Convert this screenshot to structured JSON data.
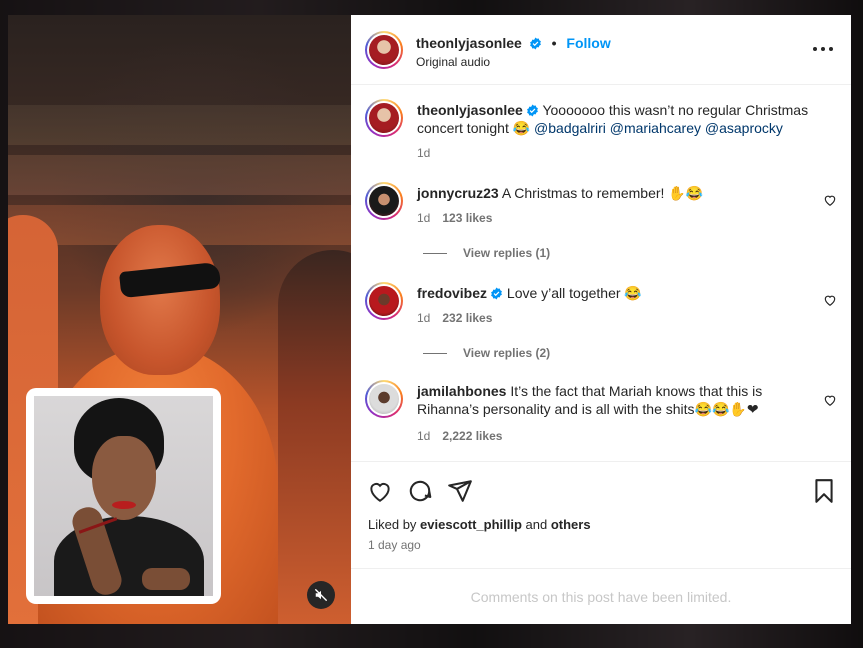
{
  "post": {
    "author": "theonlyjasonlee",
    "follow_label": "Follow",
    "separator": "•",
    "audio": "Original audio",
    "caption": {
      "username": "theonlyjasonlee",
      "text": "Yooooooo this wasn’t no regular Christmas concert tonight 😂 ",
      "mentions": [
        "@badgalriri",
        "@mariahcarey",
        "@asaprocky"
      ],
      "time": "1d"
    }
  },
  "comments": [
    {
      "username": "jonnycruz23",
      "verified": false,
      "text": "A Christmas to remember! ✋😂",
      "time": "1d",
      "likes": "123 likes",
      "replies": "View replies (1)"
    },
    {
      "username": "fredovibez",
      "verified": true,
      "text": "Love y’all together 😂",
      "time": "1d",
      "likes": "232 likes",
      "replies": "View replies (2)"
    },
    {
      "username": "jamilahbones",
      "verified": false,
      "text": "It’s the fact that Mariah knows that this is Rihanna’s personality and is all with the shits😂😂✋❤",
      "time": "1d",
      "likes": "2,222 likes"
    }
  ],
  "liked_by": {
    "prefix": "Liked by ",
    "user": "eviescott_phillip",
    "middle": " and ",
    "others": "others"
  },
  "time_ago": "1 day ago",
  "comments_limited": "Comments on this post have been limited.",
  "icons": {
    "verified": "verified-badge-icon",
    "more": "more-options-icon",
    "like": "heart-icon",
    "comment": "comment-icon",
    "share": "send-icon",
    "save": "bookmark-icon",
    "mute": "volume-muted-icon"
  },
  "colors": {
    "link": "#0095f6",
    "verified": "#0095f6",
    "mention": "#00376b",
    "muted_text": "#737373",
    "limited_text": "#c7c7c7"
  }
}
